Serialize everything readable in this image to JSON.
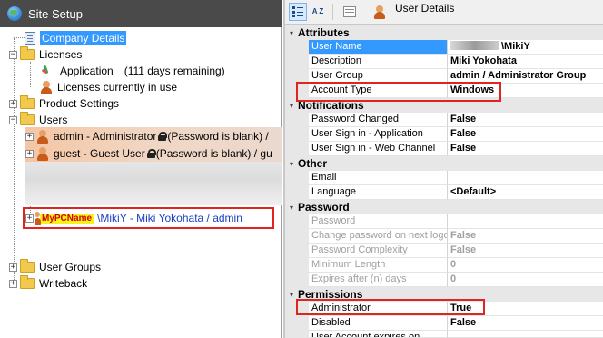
{
  "window": {
    "title": "Site Setup"
  },
  "tree": {
    "company_details": "Company Details",
    "licenses": "Licenses",
    "application_label": "Application",
    "application_remaining": "(111 days remaining)",
    "licenses_in_use": "Licenses currently in use",
    "product_settings": "Product Settings",
    "users": "Users",
    "admin_user": "admin - Administrator",
    "admin_password": "(Password is blank) /",
    "guest_user": "guest - Guest User",
    "guest_password": "(Password is blank) / gu",
    "pc_name": "MyPCName",
    "mikiy_user": "\\MikiY - Miki Yokohata / admin",
    "user_groups": "User Groups",
    "writeback": "Writeback"
  },
  "toolbar": {
    "sort_alpha": "A Z",
    "title": "User Details"
  },
  "grid": {
    "attributes": "Attributes",
    "user_name_label": "User Name",
    "user_name_value": "\\MikiY",
    "description_label": "Description",
    "description_value": "Miki Yokohata",
    "user_group_label": "User Group",
    "user_group_value": "admin / Administrator Group",
    "account_type_label": "Account Type",
    "account_type_value": "Windows",
    "notifications": "Notifications",
    "password_changed_label": "Password Changed",
    "password_changed_value": "False",
    "signin_app_label": "User Sign in - Application",
    "signin_app_value": "False",
    "signin_web_label": "User Sign in - Web Channel",
    "signin_web_value": "False",
    "other": "Other",
    "email_label": "Email",
    "email_value": "",
    "language_label": "Language",
    "language_value": "<Default>",
    "password_cat": "Password",
    "password_label": "Password",
    "password_value": "",
    "change_pw_label": "Change password on next logo",
    "change_pw_value": "False",
    "pw_complexity_label": "Password Complexity",
    "pw_complexity_value": "False",
    "min_length_label": "Minimum Length",
    "min_length_value": "0",
    "expires_label": "Expires after (n) days",
    "expires_value": "0",
    "permissions": "Permissions",
    "administrator_label": "Administrator",
    "administrator_value": "True",
    "disabled_label": "Disabled",
    "disabled_value": "False",
    "account_expires_label": "User Account expires on"
  },
  "colors": {
    "highlight_red": "#e0241f",
    "selection_blue": "#3399ff",
    "title_bar": "#4a4a4a"
  }
}
